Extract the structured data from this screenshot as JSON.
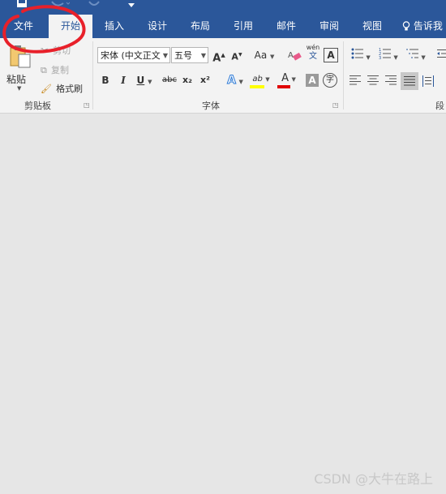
{
  "tabs": [
    {
      "id": "file",
      "label": "文件"
    },
    {
      "id": "home",
      "label": "开始"
    },
    {
      "id": "insert",
      "label": "插入"
    },
    {
      "id": "design",
      "label": "设计"
    },
    {
      "id": "layout",
      "label": "布局"
    },
    {
      "id": "references",
      "label": "引用"
    },
    {
      "id": "mailings",
      "label": "邮件"
    },
    {
      "id": "review",
      "label": "审阅"
    },
    {
      "id": "view",
      "label": "视图"
    }
  ],
  "tell_me": {
    "label": "告诉我"
  },
  "clipboard": {
    "paste_label": "粘贴",
    "cut_label": "剪切",
    "copy_label": "复制",
    "format_painter_label": "格式刷",
    "group_label": "剪贴板"
  },
  "font": {
    "font_name": "宋体 (中文正文",
    "font_size": "五号",
    "grow_label": "A",
    "shrink_label": "A",
    "case_label": "Aa",
    "phonetic_label": "wén",
    "phonetic_sub": "文",
    "border_char_label": "A",
    "bold_label": "B",
    "italic_label": "I",
    "underline_label": "U",
    "strike_label": "abc",
    "subscript_label": "x₂",
    "superscript_label": "x²",
    "effects_label": "A",
    "highlight_label": "ab",
    "font_color_label": "A",
    "shading_label": "A",
    "enclose_label": "字",
    "group_label": "字体"
  },
  "paragraph": {
    "group_label": "段"
  },
  "watermark": "CSDN @大牛在路上",
  "colors": {
    "ribbon_blue": "#2b579a",
    "annotation_red": "#e8202a",
    "highlight_yellow": "#ffff00",
    "font_color_red": "#e00000"
  }
}
